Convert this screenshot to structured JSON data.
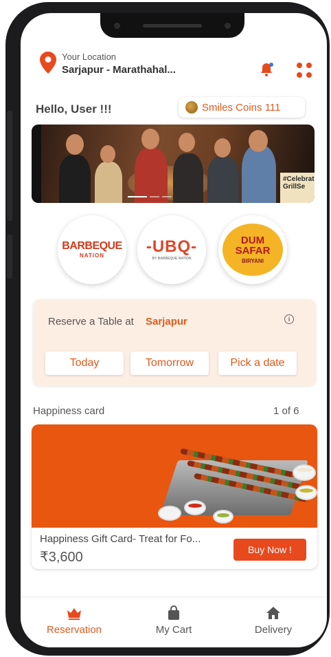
{
  "header": {
    "location_caption": "Your Location",
    "location_value": "Sarjapur - Marathahal..."
  },
  "greeting": "Hello, User !!!",
  "coins": {
    "label": "Smiles Coins 111"
  },
  "banner": {
    "tag_text": "#Celebrate GrillSe"
  },
  "brands": [
    {
      "name": "BARBEQUE",
      "sub": "NATION"
    },
    {
      "name": "-UBQ-",
      "sub": "BY BARBEQUE NATION"
    },
    {
      "name": "DUM SAFAR",
      "sub": "BIRYANI"
    }
  ],
  "reserve": {
    "label": "Reserve a Table at",
    "city": "Sarjapur",
    "buttons": [
      "Today",
      "Tomorrow",
      "Pick a date"
    ]
  },
  "happiness": {
    "title": "Happiness card",
    "page": "1 of 6",
    "card_name": "Happiness Gift Card- Treat for Fo...",
    "price": "₹3,600",
    "buy_label": "Buy Now !"
  },
  "nav": [
    {
      "label": "Reservation",
      "icon": "crown-icon",
      "active": true
    },
    {
      "label": "My Cart",
      "icon": "bag-icon",
      "active": false
    },
    {
      "label": "Delivery",
      "icon": "home-icon",
      "active": false
    }
  ],
  "colors": {
    "accent": "#e05a1c",
    "button": "#e8491d",
    "reserve_bg": "#fdeee4"
  }
}
